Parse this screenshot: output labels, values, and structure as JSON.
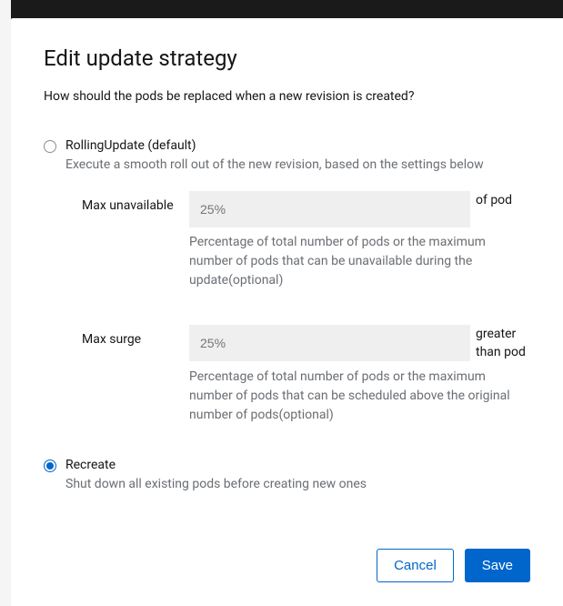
{
  "modal": {
    "title": "Edit update strategy",
    "description": "How should the pods be replaced when a new revision is created?"
  },
  "options": {
    "rolling": {
      "label": "RollingUpdate (default)",
      "sub": "Execute a smooth roll out of the new revision, based on the settings below",
      "selected": false,
      "maxUnavailable": {
        "label": "Max unavailable",
        "placeholder": "25%",
        "value": "",
        "suffix": "of pod",
        "help": "Percentage of total number of pods or the maximum number of pods that can be unavailable during the update(optional)"
      },
      "maxSurge": {
        "label": "Max surge",
        "placeholder": "25%",
        "value": "",
        "suffix": "greater than pod",
        "help": "Percentage of total number of pods or the maximum number of pods that can be scheduled above the original number of pods(optional)"
      }
    },
    "recreate": {
      "label": "Recreate",
      "sub": "Shut down all existing pods before creating new ones",
      "selected": true
    }
  },
  "footer": {
    "cancel": "Cancel",
    "save": "Save"
  }
}
